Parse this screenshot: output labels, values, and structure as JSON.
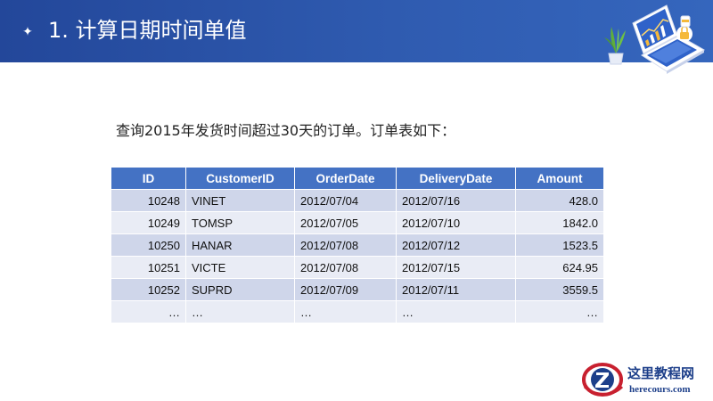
{
  "header": {
    "bullet": "✦",
    "title": "1. 计算日期时间单值"
  },
  "intro": "查询2015年发货时间超过30天的订单。订单表如下：",
  "table": {
    "columns": [
      "ID",
      "CustomerID",
      "OrderDate",
      "DeliveryDate",
      "Amount"
    ],
    "rows": [
      [
        "10248",
        "VINET",
        "2012/07/04",
        "2012/07/16",
        "428.0"
      ],
      [
        "10249",
        "TOMSP",
        "2012/07/05",
        "2012/07/10",
        "1842.0"
      ],
      [
        "10250",
        "HANAR",
        "2012/07/08",
        "2012/07/12",
        "1523.5"
      ],
      [
        "10251",
        "VICTE",
        "2012/07/08",
        "2012/07/15",
        "624.95"
      ],
      [
        "10252",
        "SUPRD",
        "2012/07/09",
        "2012/07/11",
        "3559.5"
      ],
      [
        "…",
        "…",
        "…",
        "…",
        "…"
      ]
    ]
  },
  "watermark": {
    "name_cn": "这里教程网",
    "domain": "herecours.com"
  },
  "colors": {
    "header_bg": "#2f5bb0",
    "table_header": "#4472c4",
    "row_dark": "#cfd6ea",
    "row_light": "#e9ecf5"
  },
  "icons": [
    "sparkle-bullet-icon",
    "laptop-chart-illustration",
    "site-logo"
  ]
}
